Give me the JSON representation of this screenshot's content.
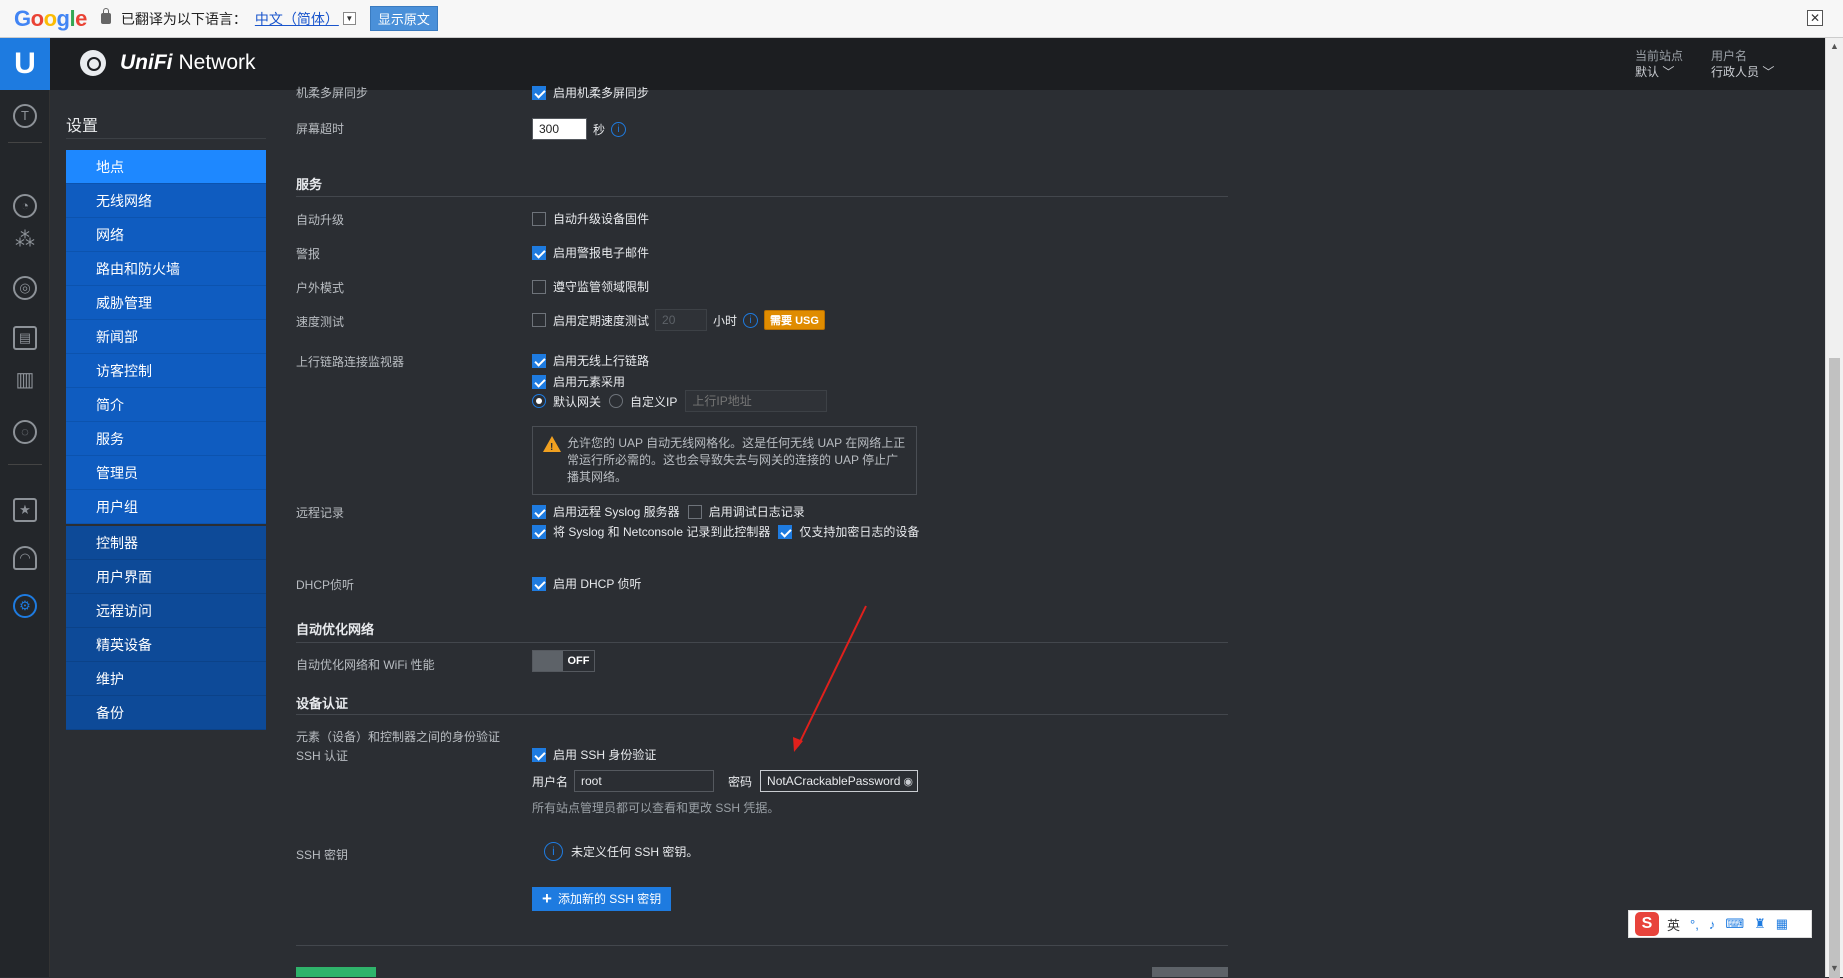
{
  "translate_bar": {
    "logo": [
      "G",
      "o",
      "o",
      "g",
      "l",
      "e"
    ],
    "text": "已翻译为以下语言：",
    "language": "中文（简体）",
    "show_original": "显示原文",
    "close": "✕"
  },
  "header": {
    "brand_emphasis": "UniFi",
    "brand_name": "Network",
    "site_label": "当前站点",
    "site_value": "默认",
    "user_label": "用户名",
    "user_value": "行政人员"
  },
  "settings_nav": {
    "title": "设置",
    "items": [
      "地点",
      "无线网络",
      "网络",
      "路由和防火墙",
      "威胁管理",
      "新闻部",
      "访客控制",
      "简介",
      "服务",
      "管理员",
      "用户组"
    ],
    "items2": [
      "控制器",
      "用户界面",
      "远程访问",
      "精英设备",
      "维护",
      "备份"
    ]
  },
  "main": {
    "top_partial_label": "机柔多屏同步",
    "top_partial_ctl": "启用机柔多屏同步",
    "screen_timeout": {
      "label": "屏幕超时",
      "value": "300",
      "unit": "秒"
    },
    "services": {
      "title": "服务",
      "auto_upgrade": {
        "label": "自动升级",
        "ctl": "自动升级设备固件"
      },
      "alerts": {
        "label": "警报",
        "ctl": "启用警报电子邮件"
      },
      "outdoor": {
        "label": "户外模式",
        "ctl": "遵守监管领域限制"
      },
      "speedtest": {
        "label": "速度测试",
        "ctl": "启用定期速度测试",
        "value": "20",
        "unit": "小时",
        "badge": "需要 USG"
      },
      "uplink": {
        "label": "上行链路连接监视器",
        "opt1": "启用无线上行链路",
        "opt2": "启用元素采用",
        "radio1": "默认网关",
        "radio2": "自定义IP",
        "ip_placeholder": "上行IP地址",
        "note": "允许您的 UAP 自动无线网格化。这是任何无线 UAP 在网络上正常运行所必需的。这也会导致失去与网关的连接的 UAP 停止广播其网络。"
      },
      "remote_log": {
        "label": "远程记录",
        "opt1": "启用远程 Syslog 服务器",
        "opt2": "启用调试日志记录",
        "opt3": "将 Syslog 和 Netconsole 记录到此控制器",
        "opt4": "仅支持加密日志的设备"
      },
      "dhcp": {
        "label": "DHCP侦听",
        "ctl": "启用 DHCP 侦听"
      }
    },
    "auto_opt": {
      "title": "自动优化网络",
      "label": "自动优化网络和 WiFi 性能",
      "toggle": "OFF"
    },
    "device_auth": {
      "title": "设备认证",
      "desc": "元素（设备）和控制器之间的身份验证",
      "ssh_label": "SSH 认证",
      "ssh_ctl": "启用 SSH 身份验证",
      "user_label": "用户名",
      "user_value": "root",
      "pass_label": "密码",
      "pass_value": "NotACrackablePassword",
      "hint": "所有站点管理员都可以查看和更改 SSH 凭据。",
      "key_label": "SSH 密钥",
      "key_empty": "未定义任何 SSH 密钥。",
      "add_key": "添加新的 SSH 密钥"
    }
  },
  "ime": {
    "lang": "英"
  },
  "colors": {
    "accent": "#1e7be0",
    "nav_bg": "#0f5cc0",
    "nav_active": "#1e88ff",
    "badge": "#e08c00",
    "annotation_arrow": "#e0201c"
  }
}
